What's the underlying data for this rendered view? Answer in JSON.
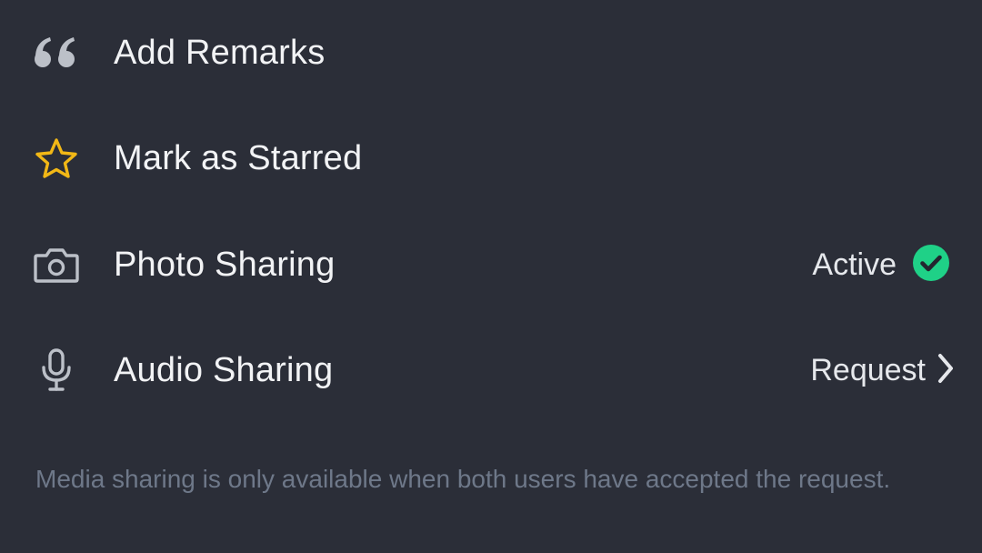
{
  "menu": {
    "items": [
      {
        "icon": "quote-icon",
        "label": "Add Remarks"
      },
      {
        "icon": "star-icon",
        "label": "Mark as Starred",
        "icon_color": "#f2b816"
      },
      {
        "icon": "camera-icon",
        "label": "Photo Sharing",
        "status": "Active",
        "status_icon": "check-circle-icon",
        "status_color": "#1fd187"
      },
      {
        "icon": "microphone-icon",
        "label": "Audio Sharing",
        "status": "Request",
        "status_icon": "chevron-right-icon"
      }
    ]
  },
  "footer": {
    "note": "Media sharing is only available when both users have accepted the request."
  },
  "colors": {
    "background": "#2b2e38",
    "text": "#f2f3f5",
    "icon": "#bcc0c8",
    "muted": "#6e7889",
    "accent_star": "#f2b816",
    "accent_active": "#1fd187"
  }
}
